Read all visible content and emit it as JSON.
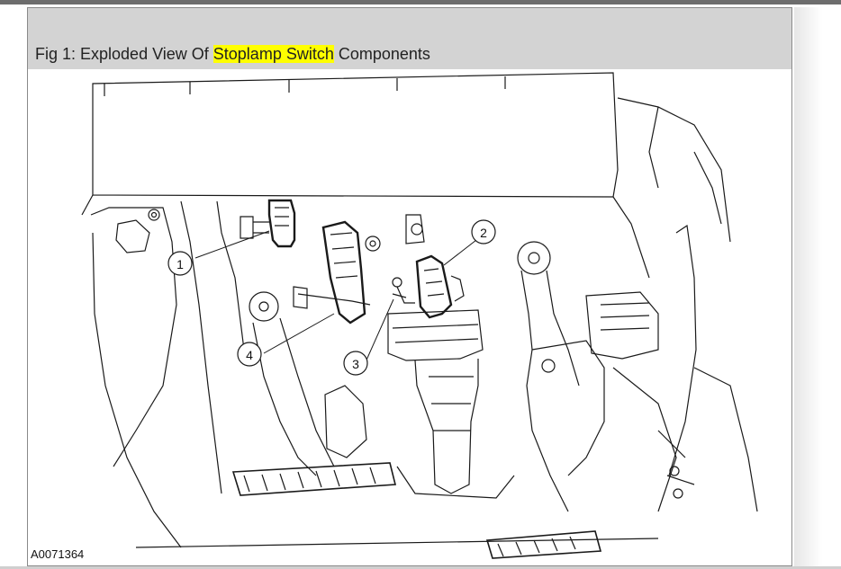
{
  "caption": {
    "prefix": "Fig 1: Exploded View Of ",
    "highlight": "Stoplamp Switch",
    "suffix": " Components"
  },
  "callouts": [
    "1",
    "2",
    "3",
    "4"
  ],
  "figure_id": "A0071364",
  "colors": {
    "highlight": "#ffff00",
    "caption_bar": "#d3d3d3",
    "line": "#1a1a1a"
  }
}
